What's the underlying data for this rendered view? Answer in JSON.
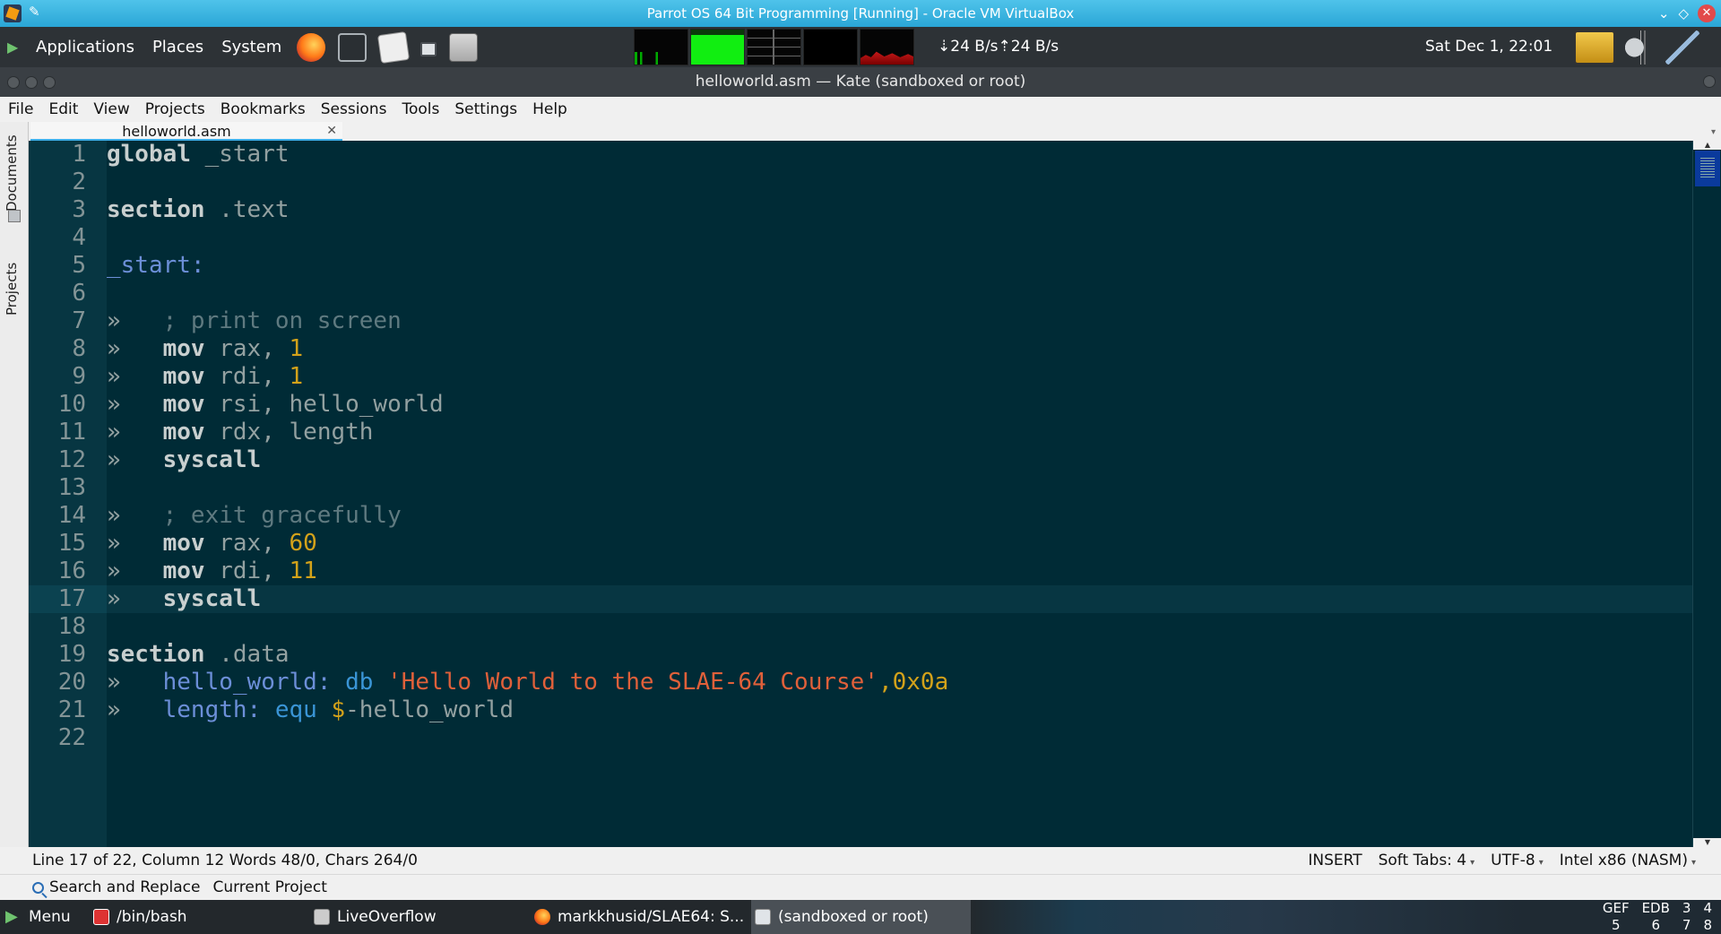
{
  "vbox_title": "Parrot OS 64 Bit Programming [Running] - Oracle VM VirtualBox",
  "top_panel": {
    "menus": [
      "Applications",
      "Places",
      "System"
    ],
    "net_down": "24 B/s",
    "net_up": "24 B/s",
    "clock": "Sat Dec 1, 22:01"
  },
  "kate_title": "helloworld.asm  — Kate (sandboxed or root)",
  "menubar": [
    "File",
    "Edit",
    "View",
    "Projects",
    "Bookmarks",
    "Sessions",
    "Tools",
    "Settings",
    "Help"
  ],
  "side_dock": {
    "documents": "Documents",
    "projects": "Projects"
  },
  "tab": {
    "label": "helloworld.asm",
    "close": "✕"
  },
  "editor": {
    "current_line": 17,
    "lines": [
      [
        {
          "t": "kw",
          "v": "global"
        },
        {
          "t": "plain",
          "v": " _start"
        }
      ],
      [],
      [
        {
          "t": "kw",
          "v": "section"
        },
        {
          "t": "plain",
          "v": " .text"
        }
      ],
      [],
      [
        {
          "t": "label",
          "v": "_start:"
        }
      ],
      [],
      [
        {
          "t": "tab",
          "v": "»   "
        },
        {
          "t": "cmt",
          "v": "; print on screen"
        }
      ],
      [
        {
          "t": "tab",
          "v": "»   "
        },
        {
          "t": "kw",
          "v": "mov"
        },
        {
          "t": "plain",
          "v": " rax, "
        },
        {
          "t": "num",
          "v": "1"
        }
      ],
      [
        {
          "t": "tab",
          "v": "»   "
        },
        {
          "t": "kw",
          "v": "mov"
        },
        {
          "t": "plain",
          "v": " rdi, "
        },
        {
          "t": "num",
          "v": "1"
        }
      ],
      [
        {
          "t": "tab",
          "v": "»   "
        },
        {
          "t": "kw",
          "v": "mov"
        },
        {
          "t": "plain",
          "v": " rsi, hello_world"
        }
      ],
      [
        {
          "t": "tab",
          "v": "»   "
        },
        {
          "t": "kw",
          "v": "mov"
        },
        {
          "t": "plain",
          "v": " rdx, length"
        }
      ],
      [
        {
          "t": "tab",
          "v": "»   "
        },
        {
          "t": "kw",
          "v": "syscall"
        }
      ],
      [],
      [
        {
          "t": "tab",
          "v": "»   "
        },
        {
          "t": "cmt",
          "v": "; exit gracefully"
        }
      ],
      [
        {
          "t": "tab",
          "v": "»   "
        },
        {
          "t": "kw",
          "v": "mov"
        },
        {
          "t": "plain",
          "v": " rax, "
        },
        {
          "t": "num",
          "v": "60"
        }
      ],
      [
        {
          "t": "tab",
          "v": "»   "
        },
        {
          "t": "kw",
          "v": "mov"
        },
        {
          "t": "plain",
          "v": " rdi, "
        },
        {
          "t": "num",
          "v": "11"
        }
      ],
      [
        {
          "t": "tab",
          "v": "»   "
        },
        {
          "t": "kw",
          "v": "syscall"
        }
      ],
      [],
      [
        {
          "t": "kw",
          "v": "section"
        },
        {
          "t": "plain",
          "v": " .data"
        }
      ],
      [
        {
          "t": "tab",
          "v": "»   "
        },
        {
          "t": "label",
          "v": "hello_world:"
        },
        {
          "t": "plain",
          "v": " "
        },
        {
          "t": "dir",
          "v": "db"
        },
        {
          "t": "plain",
          "v": " "
        },
        {
          "t": "str",
          "v": "'Hello World to the SLAE-64 Course'"
        },
        {
          "t": "num",
          "v": ",0x0a"
        }
      ],
      [
        {
          "t": "tab",
          "v": "»   "
        },
        {
          "t": "label",
          "v": "length:"
        },
        {
          "t": "plain",
          "v": " "
        },
        {
          "t": "dir",
          "v": "equ"
        },
        {
          "t": "plain",
          "v": " "
        },
        {
          "t": "dollar",
          "v": "$"
        },
        {
          "t": "plain",
          "v": "-hello_world"
        }
      ],
      []
    ]
  },
  "statusbar": {
    "position": "Line 17 of 22, Column 12 Words 48/0, Chars 264/0",
    "mode": "INSERT",
    "tabs": "Soft Tabs: 4",
    "encoding": "UTF-8",
    "syntax": "Intel x86 (NASM)"
  },
  "toolviews": {
    "search_replace": "Search and Replace",
    "current_project": "Current Project"
  },
  "taskbar": {
    "menu": "Menu",
    "items": [
      "/bin/bash",
      "LiveOverflow",
      "markkhusid/SLAE64: S...",
      "(sandboxed or root)"
    ],
    "indicators": [
      "GEF",
      "EDB",
      "3",
      "4",
      "5",
      "6",
      "7",
      "8"
    ]
  }
}
